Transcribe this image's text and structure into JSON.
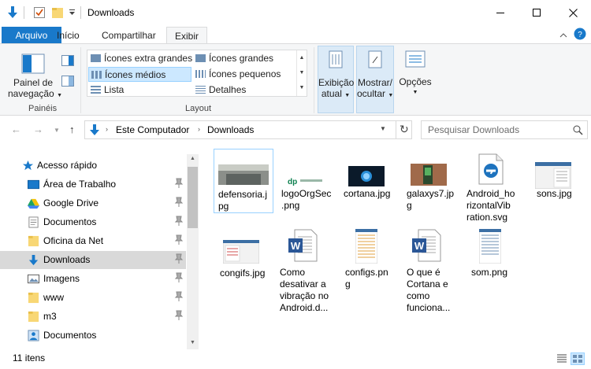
{
  "window": {
    "title": "Downloads",
    "min_icon": "minimize-icon",
    "max_icon": "maximize-icon",
    "close_icon": "close-icon"
  },
  "ribbon_tabs": [
    "Arquivo",
    "Início",
    "Compartilhar",
    "Exibir"
  ],
  "ribbon": {
    "panes_button": [
      "Painel de",
      "navegação"
    ],
    "panes_group": "Painéis",
    "layout_group": "Layout",
    "layout_options": [
      "Ícones extra grandes",
      "Ícones grandes",
      "Ícones médios",
      "Ícones pequenos",
      "Lista",
      "Detalhes"
    ],
    "current_view": [
      "Exibição",
      "atual"
    ],
    "show_hide": [
      "Mostrar/",
      "ocultar"
    ],
    "options": "Opções"
  },
  "address": {
    "path": [
      "Este Computador",
      "Downloads"
    ],
    "search_placeholder": "Pesquisar Downloads"
  },
  "nav_pane": {
    "quick_access": "Acesso rápido",
    "items": [
      {
        "label": "Área de Trabalho",
        "icon": "desktop-icon",
        "pinned": true
      },
      {
        "label": "Google Drive",
        "icon": "google-drive-icon",
        "pinned": true
      },
      {
        "label": "Documentos",
        "icon": "documents-icon",
        "pinned": true
      },
      {
        "label": "Oficina da Net",
        "icon": "folder-icon",
        "pinned": true
      },
      {
        "label": "Downloads",
        "icon": "downloads-icon",
        "pinned": true
      },
      {
        "label": "Imagens",
        "icon": "pictures-icon",
        "pinned": true
      },
      {
        "label": "www",
        "icon": "folder-icon",
        "pinned": true
      },
      {
        "label": "m3",
        "icon": "folder-icon",
        "pinned": true
      },
      {
        "label": "Documentos",
        "icon": "documents-icon",
        "pinned": false
      }
    ]
  },
  "files": [
    {
      "name": "defensoria.jpg",
      "lines": [
        "defensoria.j",
        "pg"
      ]
    },
    {
      "name": "logoOrgSec.png",
      "lines": [
        "logoOrgSec",
        ".png"
      ]
    },
    {
      "name": "cortana.jpg",
      "lines": [
        "cortana.jpg"
      ]
    },
    {
      "name": "galaxys7.jpg",
      "lines": [
        "galaxys7.jp",
        "g"
      ]
    },
    {
      "name": "Android_horizontalVibration.svg",
      "lines": [
        "Android_ho",
        "rizontalVib",
        "ration.svg"
      ]
    },
    {
      "name": "sons.jpg",
      "lines": [
        "sons.jpg"
      ]
    },
    {
      "name": "congifs.jpg",
      "lines": [
        "congifs.jpg"
      ]
    },
    {
      "name": "Como desativar a vibração no Android.d...",
      "lines": [
        "Como",
        "desativar a",
        "vibração no",
        "Android.d..."
      ]
    },
    {
      "name": "configs.png",
      "lines": [
        "configs.pn",
        "g"
      ]
    },
    {
      "name": "O que é Cortana e como funciona...",
      "lines": [
        "O que é",
        "Cortana e",
        "como",
        "funciona..."
      ]
    },
    {
      "name": "som.png",
      "lines": [
        "som.png"
      ]
    }
  ],
  "status": {
    "item_count": "11 itens"
  },
  "colors": {
    "accent": "#1979ca",
    "selection": "#cce8ff",
    "selection_border": "#99d1ff"
  }
}
